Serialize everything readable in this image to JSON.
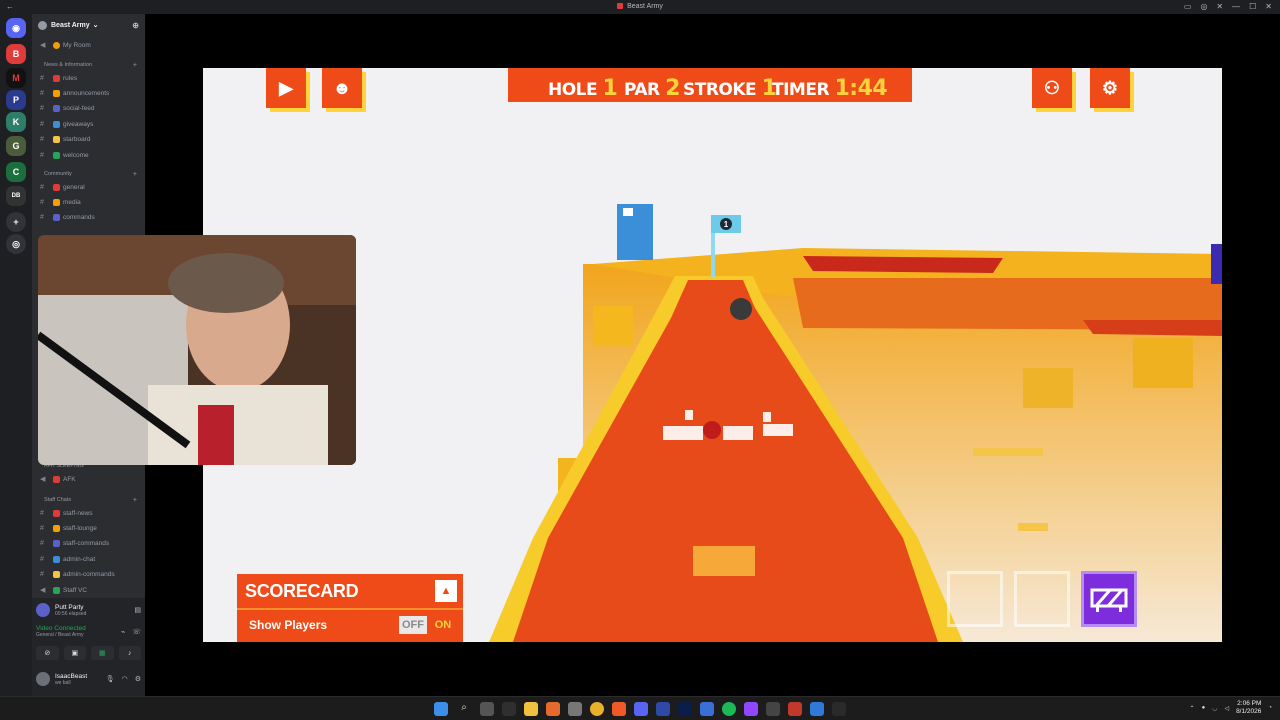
{
  "window": {
    "title": "Beast Army"
  },
  "server": {
    "name": "Beast Army"
  },
  "sidebar": {
    "my_room": "My Room",
    "categories": {
      "news": "News & Information",
      "community": "Community",
      "afk": "AFK SLEEPING",
      "staff": "Staff Chats"
    },
    "news_channels": [
      "rules",
      "announcements",
      "social-feed",
      "giveaways",
      "starboard",
      "welcome"
    ],
    "community_channels": [
      "general",
      "media",
      "commands"
    ],
    "afk_channels": [
      "AFK"
    ],
    "staff_channels": [
      "staff-news",
      "staff-lounge",
      "staff-commands",
      "admin-chat",
      "admin-commands",
      "Staff VC"
    ]
  },
  "activity": {
    "name": "Putt Party",
    "elapsed": "00:56 elapsed"
  },
  "voice": {
    "status": "Video Connected",
    "channel": "General / Beast Army"
  },
  "user": {
    "name": "IsaacBeast",
    "status": "we ball"
  },
  "game": {
    "hole_label": "HOLE",
    "hole": "1",
    "par_label": "PAR",
    "par": "2",
    "stroke_label": "STROKE",
    "stroke": "1",
    "timer_label": "TIMER",
    "timer": "1:44",
    "flag_number": "1",
    "scorecard_title": "SCORECARD",
    "show_players": "Show Players",
    "toggle_off": "OFF",
    "toggle_on": "ON"
  },
  "clock": {
    "time": "2:06 PM",
    "date": "8/1/2026"
  },
  "colors": {
    "accent": "#ee4b18",
    "highlight": "#ffd43b",
    "item": "#7d2ddc",
    "voice": "#23a55a"
  }
}
